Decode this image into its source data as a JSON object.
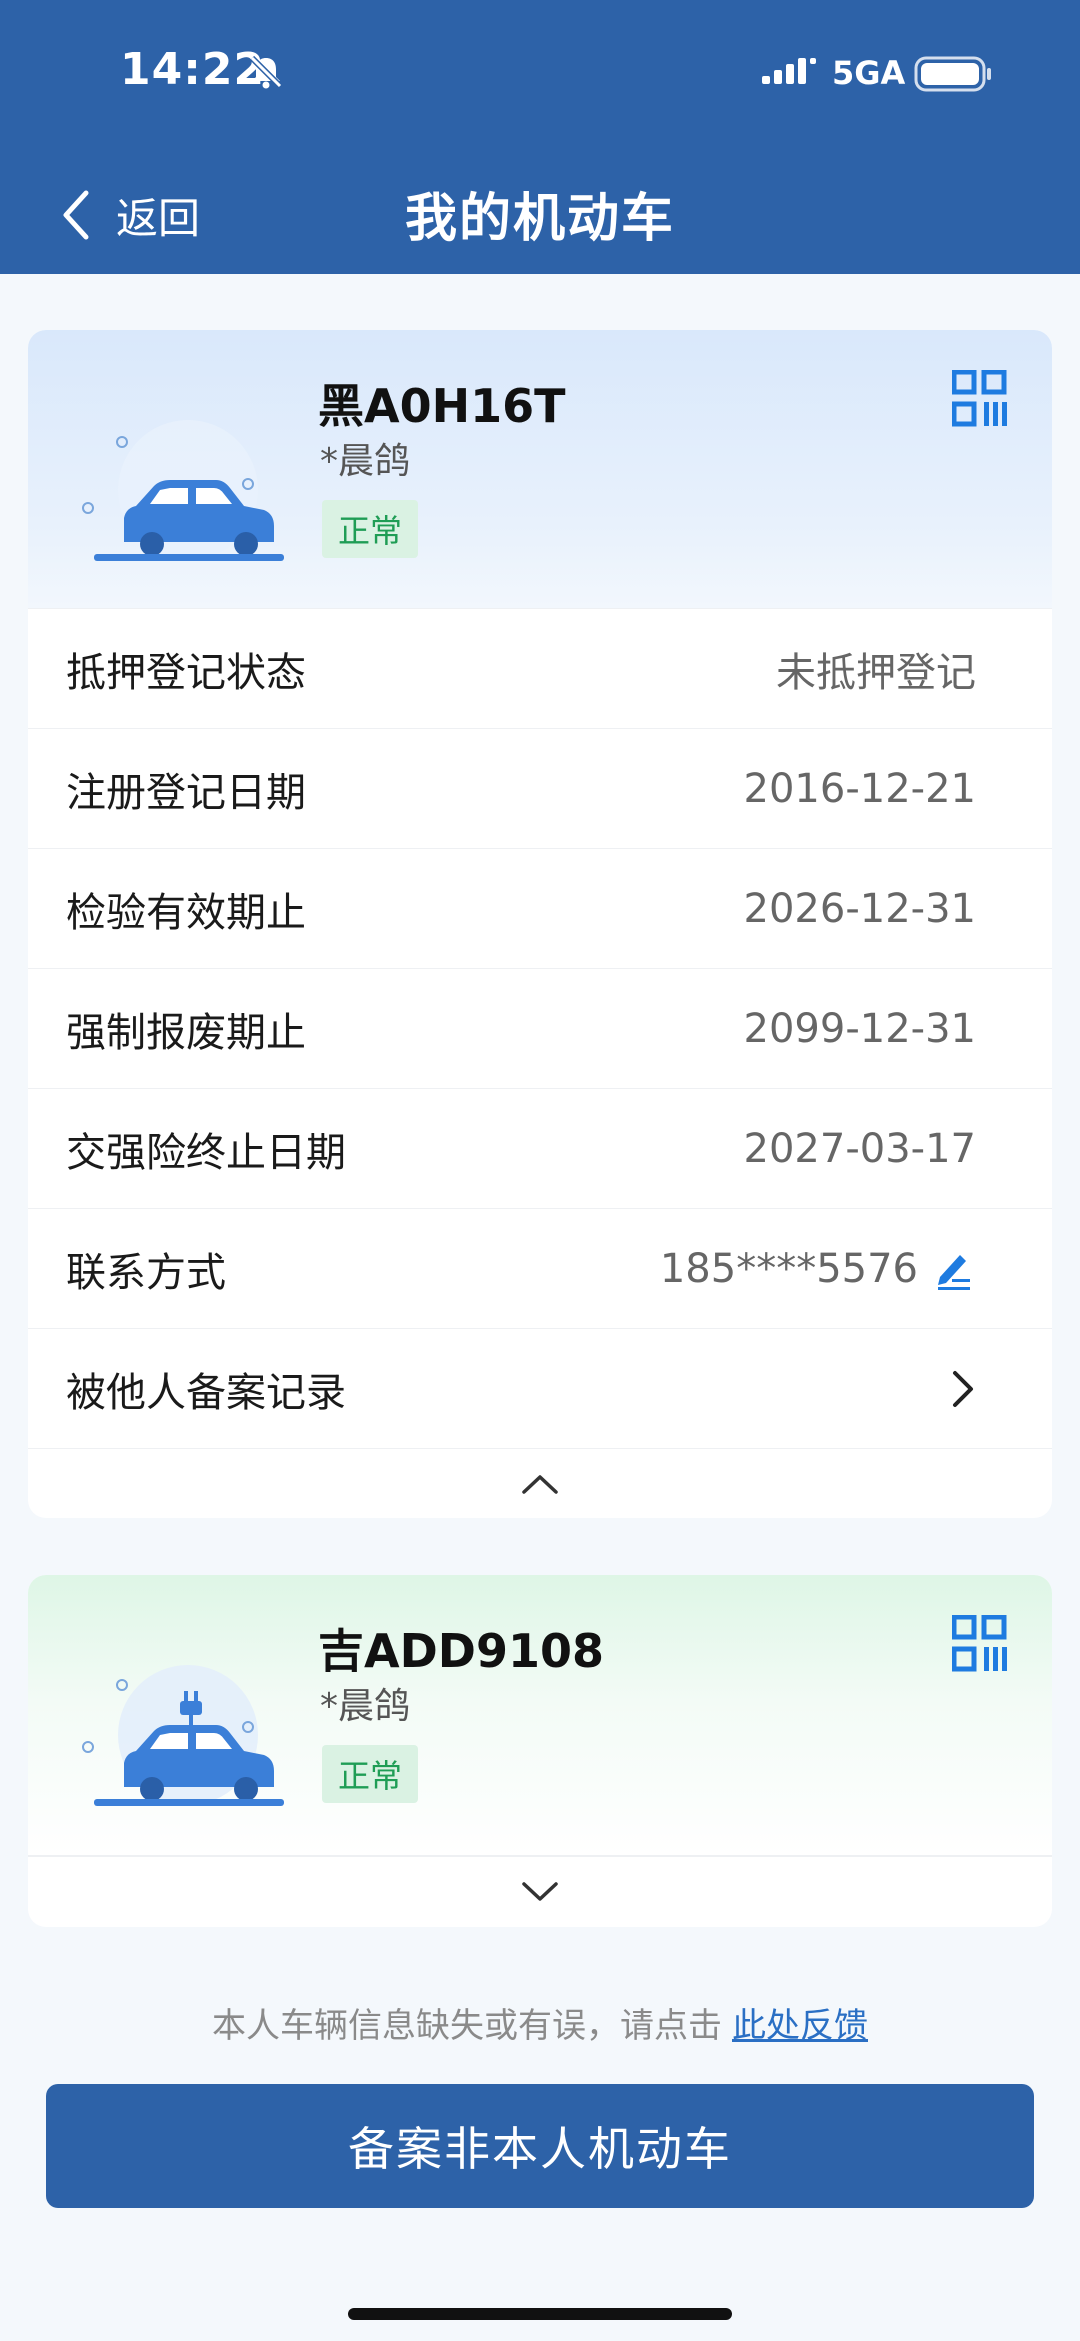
{
  "status_bar": {
    "time": "14:22",
    "network": "5GA"
  },
  "header": {
    "back_label": "返回",
    "title": "我的机动车"
  },
  "vehicles": [
    {
      "plate": "黑A0H16T",
      "owner": "*晨鸽",
      "status": "正常",
      "rows": [
        {
          "label": "抵押登记状态",
          "value": "未抵押登记"
        },
        {
          "label": "注册登记日期",
          "value": "2016-12-21"
        },
        {
          "label": "检验有效期止",
          "value": "2026-12-31"
        },
        {
          "label": "强制报废期止",
          "value": "2099-12-31"
        },
        {
          "label": "交强险终止日期",
          "value": "2027-03-17"
        },
        {
          "label": "联系方式",
          "value": "185****5576"
        },
        {
          "label": "被他人备案记录",
          "value": ""
        }
      ]
    },
    {
      "plate": "吉ADD9108",
      "owner": "*晨鸽",
      "status": "正常"
    }
  ],
  "feedback": {
    "text": "本人车辆信息缺失或有误，请点击",
    "link": "此处反馈"
  },
  "primary_button": "备案非本人机动车",
  "colors": {
    "brand_blue": "#2d62a8",
    "status_green": "#1f9d55",
    "link_blue": "#2a6fc4"
  }
}
